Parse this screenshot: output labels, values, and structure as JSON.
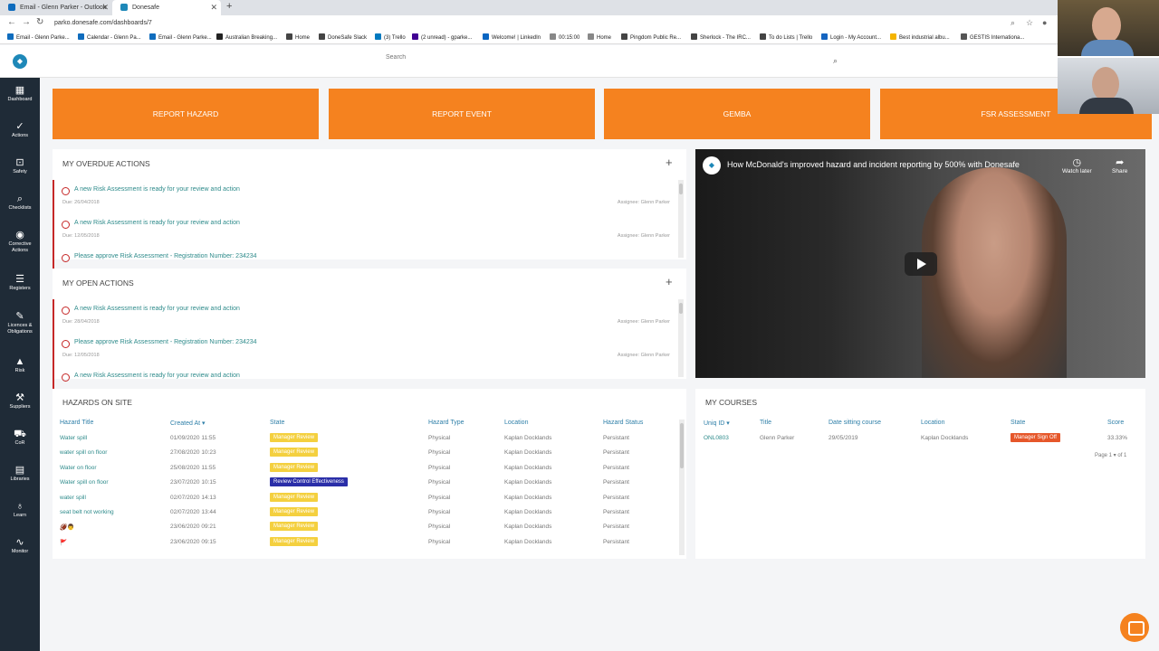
{
  "browser": {
    "tabs": [
      {
        "label": "Email - Glenn Parker - Outlook",
        "fav_color": "#0f6cbd"
      },
      {
        "label": "Donesafe",
        "fav_color": "#1e88b8"
      }
    ],
    "new_tab": "+",
    "url": "parko.donesafe.com/dashboards/7",
    "bookmarks": [
      {
        "label": "Email - Glenn Parke...",
        "color": "#0f6cbd"
      },
      {
        "label": "Calendar - Glenn Pa...",
        "color": "#0f6cbd"
      },
      {
        "label": "Email - Glenn Parke...",
        "color": "#0f6cbd"
      },
      {
        "label": "Australian Breaking...",
        "color": "#222"
      },
      {
        "label": "Home",
        "color": "#444"
      },
      {
        "label": "DoneSafe Slack",
        "color": "#444"
      },
      {
        "label": "(3) Trello",
        "color": "#0079bf"
      },
      {
        "label": "(2 unread) - gparke...",
        "color": "#410093"
      },
      {
        "label": "Welcome! | LinkedIn",
        "color": "#0a66c2"
      },
      {
        "label": "00:15:00",
        "color": "#888"
      },
      {
        "label": "Home",
        "color": "#888"
      },
      {
        "label": "Pingdom Public Re...",
        "color": "#444"
      },
      {
        "label": "Sherlock - The IRC...",
        "color": "#444"
      },
      {
        "label": "To do Lists | Trello",
        "color": "#444"
      },
      {
        "label": "Login - My Account...",
        "color": "#1565c0"
      },
      {
        "label": "Best industrial albu...",
        "color": "#f4b400"
      },
      {
        "label": "GESTIS Internationa...",
        "color": "#555"
      }
    ]
  },
  "header": {
    "search_placeholder": "Search"
  },
  "sidebar": {
    "items": [
      {
        "label": "Dashboard",
        "icon": "▦"
      },
      {
        "label": "Actions",
        "icon": "✓"
      },
      {
        "label": "Safety",
        "icon": "⊡"
      },
      {
        "label": "Checklists",
        "icon": "⌕"
      },
      {
        "label": "Corrective",
        "label2": "Actions",
        "icon": "◉"
      },
      {
        "label": "Registers",
        "icon": "☰"
      },
      {
        "label": "Licences &",
        "label2": "Obligations",
        "icon": "✎"
      },
      {
        "label": "Risk",
        "icon": "▲"
      },
      {
        "label": "Suppliers",
        "icon": "⚒"
      },
      {
        "label": "CoR",
        "icon": "⛟"
      },
      {
        "label": "Libraries",
        "icon": "▤"
      },
      {
        "label": "Learn",
        "icon": "♁"
      },
      {
        "label": "Monitor",
        "icon": "∿"
      }
    ]
  },
  "quick_buttons": [
    "REPORT HAZARD",
    "REPORT EVENT",
    "GEMBA",
    "FSR ASSESSMENT"
  ],
  "overdue_actions": {
    "title": "MY OVERDUE ACTIONS",
    "items": [
      {
        "title": "A new Risk Assessment is ready for your review and action",
        "due": "Due: 26/04/2018",
        "assignee": "Assignee: Glenn Parker"
      },
      {
        "title": "A new Risk Assessment is ready for your review and action",
        "due": "Due: 12/05/2018",
        "assignee": "Assignee: Glenn Parker"
      },
      {
        "title": "Please approve Risk Assessment - Registration Number: 234234",
        "due": "",
        "assignee": ""
      }
    ]
  },
  "open_actions": {
    "title": "MY OPEN ACTIONS",
    "items": [
      {
        "title": "A new Risk Assessment is ready for your review and action",
        "due": "Due: 28/04/2018",
        "assignee": "Assignee: Glenn Parker"
      },
      {
        "title": "Please approve Risk Assessment - Registration Number: 234234",
        "due": "Due: 12/05/2018",
        "assignee": "Assignee: Glenn Parker"
      },
      {
        "title": "A new Risk Assessment is ready for your review and action",
        "due": "",
        "assignee": ""
      }
    ]
  },
  "hazards": {
    "title": "HAZARDS ON SITE",
    "columns": [
      "Hazard Title",
      "Created At ▾",
      "State",
      "Hazard Type",
      "Location",
      "Hazard Status"
    ],
    "rows": [
      {
        "title": "Water spill",
        "created": "01/09/2020 11:55",
        "state": "Manager Review",
        "state_color": "yellow",
        "type": "Physical",
        "location": "Kaplan Docklands",
        "status": "Persistant"
      },
      {
        "title": "water spill on floor",
        "created": "27/08/2020 10:23",
        "state": "Manager Review",
        "state_color": "yellow",
        "type": "Physical",
        "location": "Kaplan Docklands",
        "status": "Persistant"
      },
      {
        "title": "Water on floor",
        "created": "25/08/2020 11:55",
        "state": "Manager Review",
        "state_color": "yellow",
        "type": "Physical",
        "location": "Kaplan Docklands",
        "status": "Persistant"
      },
      {
        "title": "Water spill on floor",
        "created": "23/07/2020 10:15",
        "state": "Review Control Effectiveness",
        "state_color": "blue",
        "type": "Physical",
        "location": "Kaplan Docklands",
        "status": "Persistant"
      },
      {
        "title": "water spill",
        "created": "02/07/2020 14:13",
        "state": "Manager Review",
        "state_color": "yellow",
        "type": "Physical",
        "location": "Kaplan Docklands",
        "status": "Persistant"
      },
      {
        "title": "seat belt not working",
        "created": "02/07/2020 13:44",
        "state": "Manager Review",
        "state_color": "yellow",
        "type": "Physical",
        "location": "Kaplan Docklands",
        "status": "Persistant"
      },
      {
        "title": "🏈👨",
        "created": "23/06/2020 09:21",
        "state": "Manager Review",
        "state_color": "yellow",
        "type": "Physical",
        "location": "Kaplan Docklands",
        "status": "Persistant"
      },
      {
        "title": "🚩",
        "created": "23/06/2020 09:15",
        "state": "Manager Review",
        "state_color": "yellow",
        "type": "Physical",
        "location": "Kaplan Docklands",
        "status": "Persistant"
      }
    ]
  },
  "video": {
    "title": "How McDonald's improved hazard and incident reporting by 500% with Donesafe",
    "watch_later": "Watch later",
    "share": "Share"
  },
  "courses": {
    "title": "MY COURSES",
    "columns": [
      "Uniq ID ▾",
      "Title",
      "Date sitting course",
      "Location",
      "State",
      "Score"
    ],
    "rows": [
      {
        "id": "ONL0803",
        "title": "Glenn Parker",
        "date": "29/05/2019",
        "location": "Kaplan Docklands",
        "state": "Manager Sign Off",
        "score": "33.33%"
      }
    ],
    "pagination": "Page 1 ▾ of 1"
  },
  "colors": {
    "accent": "#f5821f",
    "sidebar": "#1f2b37",
    "overdue": "#c62828",
    "link": "#2e8b8b"
  }
}
